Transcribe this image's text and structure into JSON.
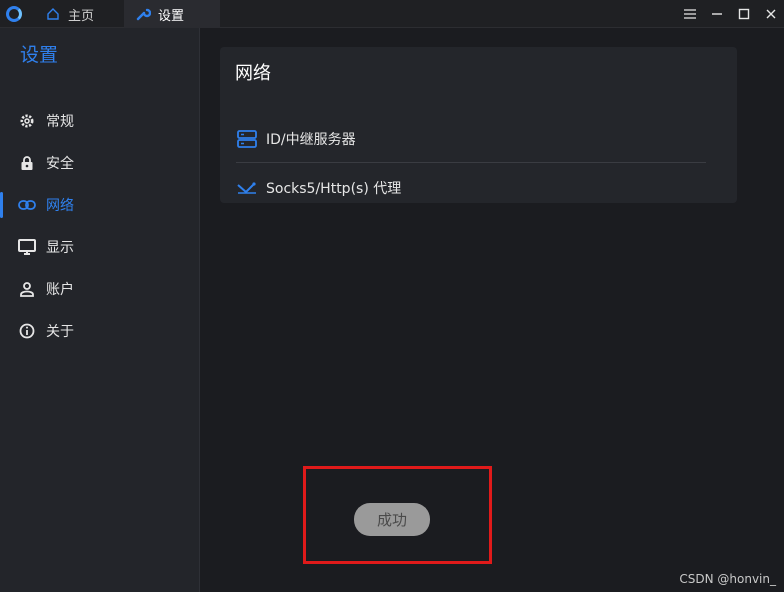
{
  "titlebar": {
    "tabs": [
      {
        "label": "主页",
        "icon": "home-icon"
      },
      {
        "label": "设置",
        "icon": "wrench-icon"
      }
    ],
    "controls": [
      "menu-icon",
      "minimize-icon",
      "maximize-icon",
      "close-icon"
    ]
  },
  "sidebar": {
    "title": "设置",
    "items": [
      {
        "label": "常规",
        "icon": "gear-icon"
      },
      {
        "label": "安全",
        "icon": "lock-icon"
      },
      {
        "label": "网络",
        "icon": "link-icon",
        "active": true
      },
      {
        "label": "显示",
        "icon": "monitor-icon"
      },
      {
        "label": "账户",
        "icon": "user-icon"
      },
      {
        "label": "关于",
        "icon": "info-icon"
      }
    ]
  },
  "main": {
    "card": {
      "title": "网络",
      "rows": [
        {
          "label": "ID/中继服务器",
          "icon": "server-icon"
        },
        {
          "label": "Socks5/Http(s) 代理",
          "icon": "proxy-icon"
        }
      ]
    },
    "toast": {
      "text": "成功"
    }
  },
  "watermark": "CSDN @honvin_",
  "colors": {
    "accent": "#2f80ed",
    "background": "#1b1c20",
    "sidebar": "#23252a",
    "card": "#24262b",
    "highlight_box": "#e01a1a"
  }
}
